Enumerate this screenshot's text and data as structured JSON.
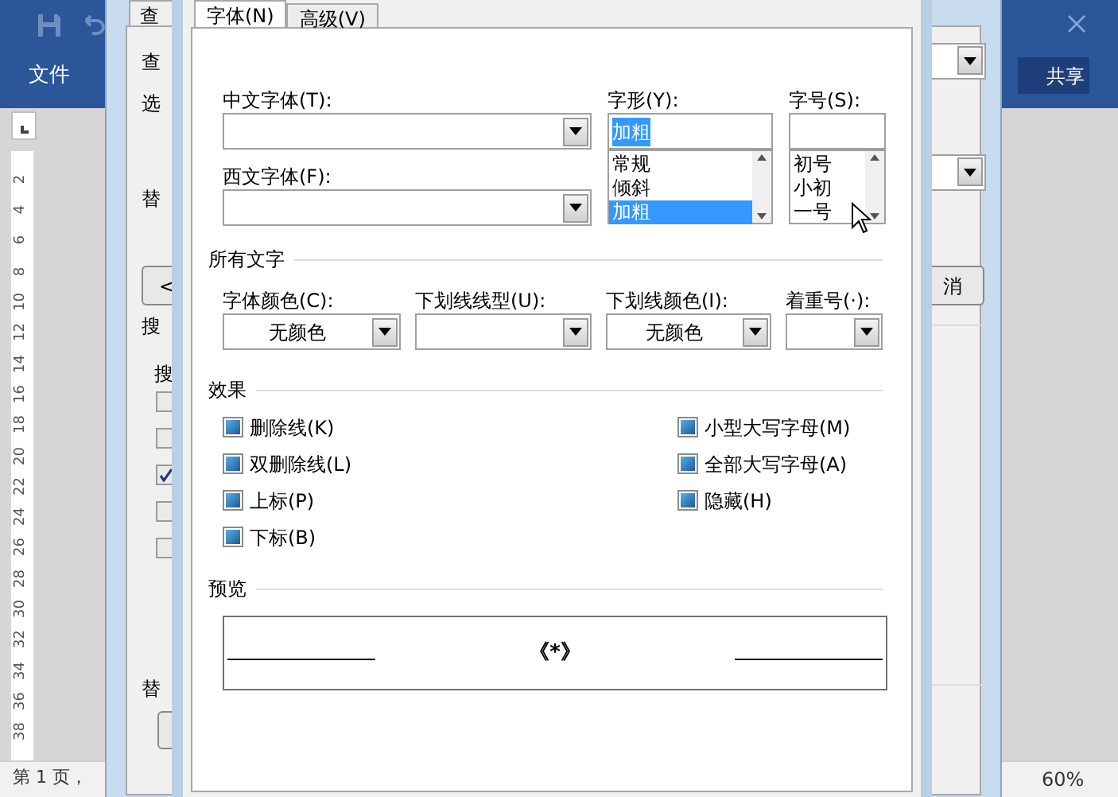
{
  "word": {
    "file_tab": "文件",
    "share_button": "共享",
    "ruler_numbers": [
      "2",
      "4",
      "6",
      "8",
      "10",
      "12",
      "14",
      "16",
      "18",
      "20",
      "22",
      "24",
      "26",
      "28",
      "30",
      "32",
      "34",
      "36",
      "38"
    ],
    "status_page": "第 1 页，",
    "zoom": "60%"
  },
  "find_dialog": {
    "tab": "查",
    "labels": [
      "查",
      "选",
      "替"
    ],
    "prev_button": "<",
    "search_label": "搜",
    "search_options_label": "搜",
    "checkboxes": [
      {
        "checked": false
      },
      {
        "checked": false
      },
      {
        "checked": true
      },
      {
        "checked": false
      },
      {
        "checked": false
      }
    ],
    "replace_label": "替",
    "cancel_button": "消"
  },
  "font_dialog": {
    "tabs": [
      {
        "label": "字体(N)",
        "selected": true
      },
      {
        "label": "高级(V)",
        "selected": false
      }
    ],
    "chinese_font": {
      "label": "中文字体(T):"
    },
    "western_font": {
      "label": "西文字体(F):"
    },
    "font_style": {
      "label": "字形(Y):",
      "value": "加粗",
      "options": [
        {
          "label": "常规",
          "selected": false
        },
        {
          "label": "倾斜",
          "selected": false
        },
        {
          "label": "加粗",
          "selected": true
        }
      ]
    },
    "font_size": {
      "label": "字号(S):",
      "options": [
        {
          "label": "初号",
          "selected": false
        },
        {
          "label": "小初",
          "selected": false
        },
        {
          "label": "一号",
          "selected": false
        }
      ]
    },
    "all_text": {
      "title": "所有文字",
      "fields": [
        {
          "label": "字体颜色(C):",
          "value": "无颜色"
        },
        {
          "label": "下划线线型(U):"
        },
        {
          "label": "下划线颜色(I):",
          "value": "无颜色"
        },
        {
          "label": "着重号(·):"
        }
      ]
    },
    "effects": {
      "title": "效果",
      "left": [
        {
          "label": "删除线(K)",
          "indeterminate": true
        },
        {
          "label": "双删除线(L)",
          "indeterminate": true
        },
        {
          "label": "上标(P)",
          "indeterminate": true
        },
        {
          "label": "下标(B)",
          "indeterminate": true
        }
      ],
      "right": [
        {
          "label": "小型大写字母(M)",
          "indeterminate": true
        },
        {
          "label": "全部大写字母(A)",
          "indeterminate": true
        },
        {
          "label": "隐藏(H)",
          "indeterminate": true
        }
      ]
    },
    "preview": {
      "title": "预览",
      "sample": "《*》"
    }
  }
}
